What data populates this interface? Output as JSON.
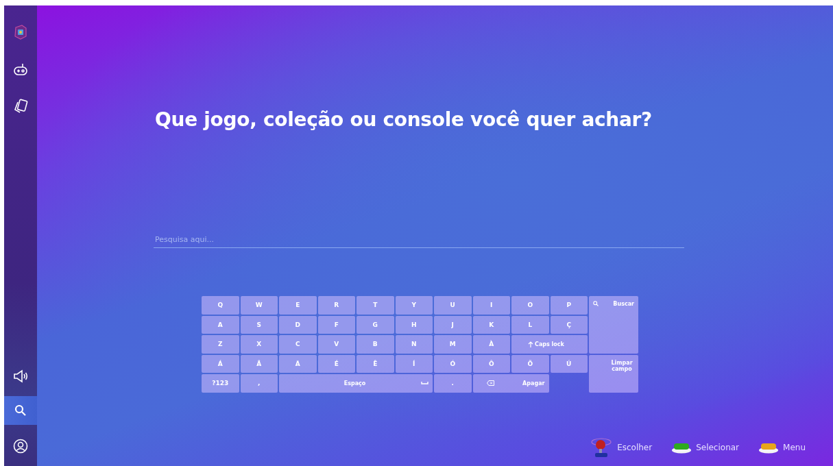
{
  "sidebar": {
    "items": [
      {
        "kind": "logo",
        "selected": false
      },
      {
        "kind": "gamepad",
        "selected": false
      },
      {
        "kind": "cards",
        "selected": false
      },
      {
        "kind": "volume",
        "selected": false
      },
      {
        "kind": "search",
        "selected": true
      },
      {
        "kind": "profile",
        "selected": false
      }
    ]
  },
  "title": "Que jogo, coleção ou console você quer achar?",
  "search": {
    "placeholder": "Pesquisa aqui..."
  },
  "keyboard": {
    "keys": [
      {
        "kind": "key",
        "label": "Q"
      },
      {
        "kind": "key",
        "label": "W"
      },
      {
        "kind": "key",
        "label": "E"
      },
      {
        "kind": "key",
        "label": "R"
      },
      {
        "kind": "key",
        "label": "T"
      },
      {
        "kind": "key",
        "label": "Y"
      },
      {
        "kind": "key",
        "label": "U"
      },
      {
        "kind": "key",
        "label": "I"
      },
      {
        "kind": "key",
        "label": "O"
      },
      {
        "kind": "key",
        "label": "P"
      },
      {
        "kind": "key",
        "label": "A"
      },
      {
        "kind": "key",
        "label": "S"
      },
      {
        "kind": "key",
        "label": "D"
      },
      {
        "kind": "key",
        "label": "F"
      },
      {
        "kind": "key",
        "label": "G"
      },
      {
        "kind": "key",
        "label": "H"
      },
      {
        "kind": "key",
        "label": "J"
      },
      {
        "kind": "key",
        "label": "K"
      },
      {
        "kind": "key",
        "label": "L"
      },
      {
        "kind": "key",
        "label": "Ç"
      },
      {
        "kind": "key",
        "label": "Z"
      },
      {
        "kind": "key",
        "label": "X"
      },
      {
        "kind": "key",
        "label": "C"
      },
      {
        "kind": "key",
        "label": "V"
      },
      {
        "kind": "key",
        "label": "B"
      },
      {
        "kind": "key",
        "label": "N"
      },
      {
        "kind": "key",
        "label": "M"
      },
      {
        "kind": "key",
        "label": "À"
      },
      {
        "kind": "caps",
        "label": "Caps lock"
      },
      {
        "kind": "key",
        "label": "Á"
      },
      {
        "kind": "key",
        "label": "Â"
      },
      {
        "kind": "key",
        "label": "Ã"
      },
      {
        "kind": "key",
        "label": "É"
      },
      {
        "kind": "key",
        "label": "Ê"
      },
      {
        "kind": "key",
        "label": "Í"
      },
      {
        "kind": "key",
        "label": "Ó"
      },
      {
        "kind": "key",
        "label": "Ô"
      },
      {
        "kind": "key",
        "label": "Õ"
      },
      {
        "kind": "key",
        "label": "Ú"
      },
      {
        "kind": "key",
        "label": "?123"
      },
      {
        "kind": "key",
        "label": ","
      },
      {
        "kind": "space",
        "label": "Espaço"
      },
      {
        "kind": "key",
        "label": "."
      },
      {
        "kind": "backspace",
        "label": "Apagar"
      }
    ],
    "side_keys": [
      {
        "kind": "search",
        "label": "Buscar"
      },
      {
        "kind": "clear",
        "label": "Limpar campo"
      }
    ]
  },
  "hints": [
    {
      "kind": "joystick",
      "label": "Escolher"
    },
    {
      "kind": "button",
      "color": "#2eaa1e",
      "label": "Selecionar"
    },
    {
      "kind": "button",
      "color": "#e8a51a",
      "label": "Menu"
    }
  ]
}
